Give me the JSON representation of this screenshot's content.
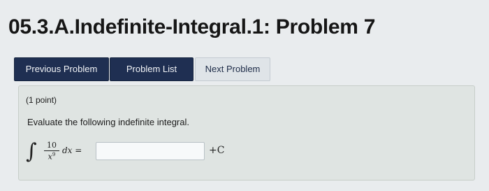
{
  "page": {
    "title": "05.3.A.Indefinite-Integral.1: Problem 7"
  },
  "nav": {
    "previous_label": "Previous Problem",
    "list_label": "Problem List",
    "next_label": "Next Problem"
  },
  "problem": {
    "points": "(1 point)",
    "prompt": "Evaluate the following indefinite integral.",
    "integral_sign": "∫",
    "numerator": "10",
    "denominator_base": "x",
    "denominator_exponent": "9",
    "differential": "dx =",
    "answer_value": "",
    "constant": "+C"
  }
}
